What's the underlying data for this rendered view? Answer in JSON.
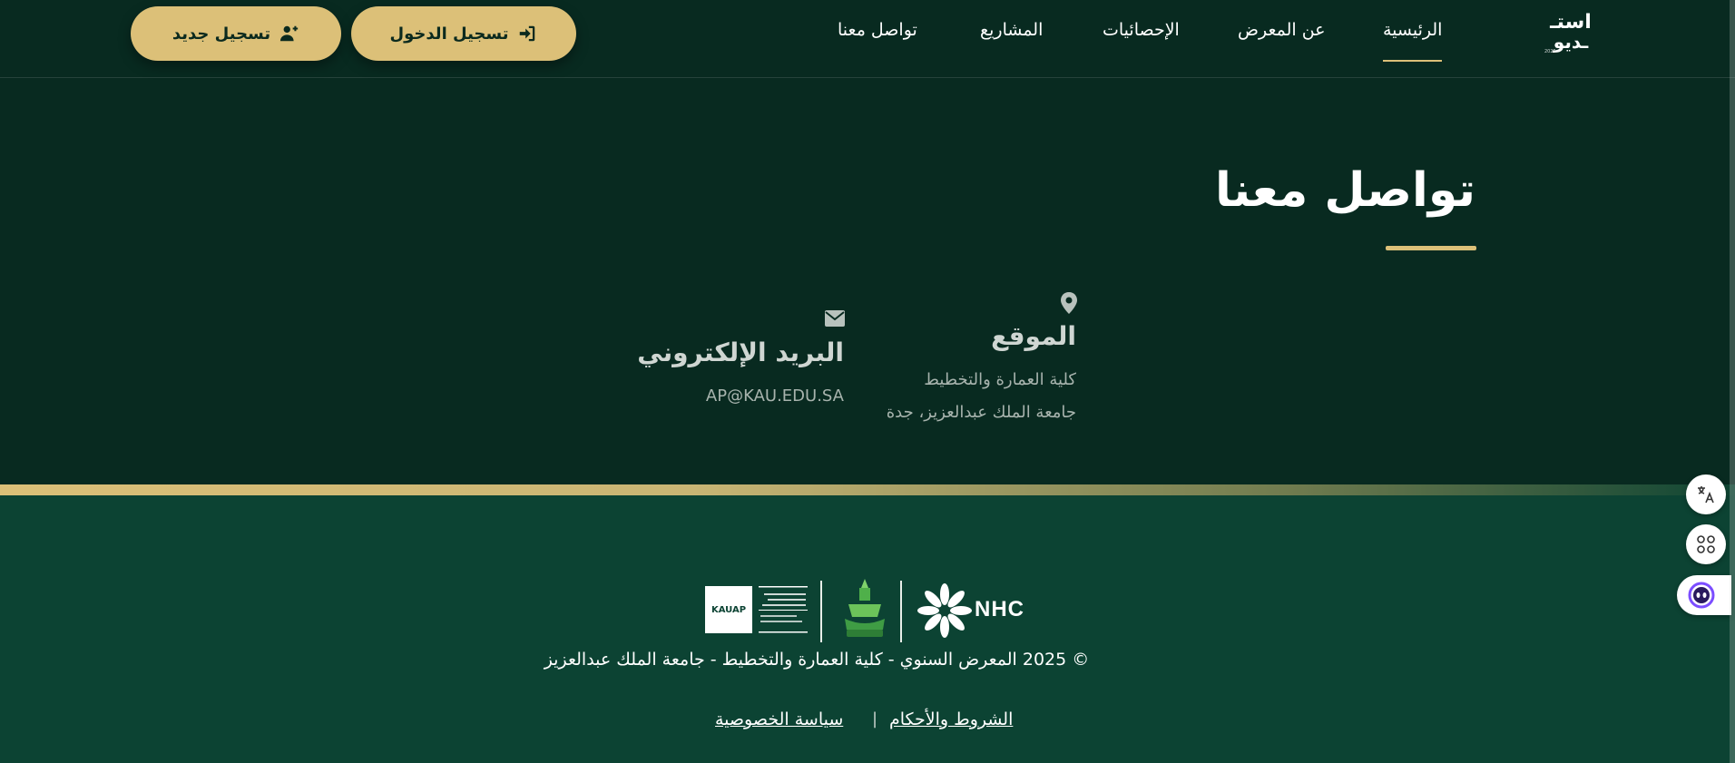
{
  "header": {
    "logo_line1": "استـ",
    "logo_line2": "ـديو",
    "logo_year": "2025",
    "nav": [
      "الرئيسية",
      "عن المعرض",
      "الإحصائيات",
      "المشاريع",
      "تواصل معنا"
    ],
    "login_label": "تسجيل الدخول",
    "register_label": "تسجيل جديد"
  },
  "contact": {
    "title": "تواصل معنا",
    "location_heading": "الموقع",
    "location_line1": "كلية العمارة والتخطيط",
    "location_line2": "جامعة الملك عبدالعزيز، جدة",
    "email_heading": "البريد الإلكتروني",
    "email_value": "AP@KAU.EDU.SA"
  },
  "footer": {
    "kauap_badge": "KAUAP",
    "nhc": "NHC",
    "copyright": "© 2025 المعرض السنوي - كلية العمارة والتخطيط - جامعة الملك عبدالعزيز",
    "terms": "الشروط والأحكام",
    "separator": "|",
    "privacy": "سياسة الخصوصية"
  },
  "colors": {
    "background": "#082a20",
    "footer": "#0c4333",
    "accent_gold": "#dcc078"
  },
  "icons": {
    "login": "sign-in-icon",
    "register": "user-plus-icon",
    "location": "map-pin-icon",
    "email": "envelope-icon",
    "translate": "translate-icon",
    "apps": "apps-grid-icon",
    "assistant": "assistant-bot-icon"
  }
}
